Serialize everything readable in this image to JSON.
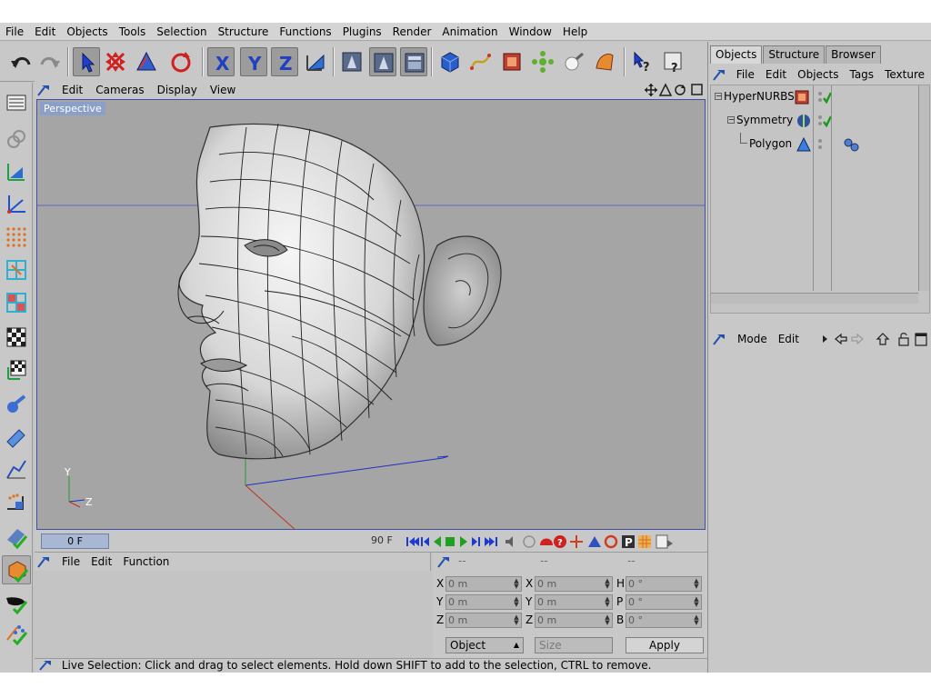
{
  "menubar": {
    "items": [
      "File",
      "Edit",
      "Objects",
      "Tools",
      "Selection",
      "Structure",
      "Functions",
      "Plugins",
      "Render",
      "Animation",
      "Window",
      "Help"
    ]
  },
  "viewport": {
    "menu": [
      "Edit",
      "Cameras",
      "Display",
      "View"
    ],
    "label": "Perspective",
    "axis_labels": {
      "y": "Y",
      "z": "Z"
    }
  },
  "timeline": {
    "current_frame": "0 F",
    "end_frame": "90 F"
  },
  "timeline_panel": {
    "menu": [
      "File",
      "Edit",
      "Function"
    ]
  },
  "coordinates": {
    "header": [
      "--",
      "--",
      "--"
    ],
    "rows": [
      {
        "pos_label": "X",
        "pos_value": "0 m",
        "size_label": "X",
        "size_value": "0 m",
        "rot_label": "H",
        "rot_value": "0 °"
      },
      {
        "pos_label": "Y",
        "pos_value": "0 m",
        "size_label": "Y",
        "size_value": "0 m",
        "rot_label": "P",
        "rot_value": "0 °"
      },
      {
        "pos_label": "Z",
        "pos_value": "0 m",
        "size_label": "Z",
        "size_value": "0 m",
        "rot_label": "B",
        "rot_value": "0 °"
      }
    ],
    "mode_select": "Object",
    "size_select": "Size",
    "apply_label": "Apply"
  },
  "statusbar": {
    "text": "Live Selection: Click and drag to select elements. Hold down SHIFT to add to the selection, CTRL to remove."
  },
  "right_panel": {
    "tabs": [
      "Objects",
      "Structure",
      "Browser"
    ],
    "menu": [
      "File",
      "Edit",
      "Objects",
      "Tags",
      "Texture"
    ],
    "objects": [
      {
        "name": "HyperNURBS",
        "icon": "hypernurbs-icon"
      },
      {
        "name": "Symmetry",
        "icon": "symmetry-icon"
      },
      {
        "name": "Polygon",
        "icon": "polygon-icon"
      }
    ],
    "attr_menu": [
      "Mode",
      "Edit"
    ]
  },
  "colors": {
    "viewport_bg": "#a5a5a5",
    "viewport_border": "#3d4fa8",
    "panel_bg": "#c8c8c8",
    "active_check": "#1a9a1a"
  }
}
